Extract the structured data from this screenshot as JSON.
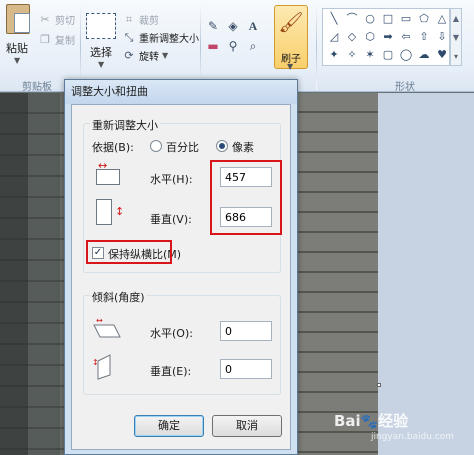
{
  "ribbon": {
    "clipboard": {
      "paste": "粘贴",
      "cut": "剪切",
      "copy": "复制",
      "group": "剪贴板"
    },
    "image": {
      "select": "选择",
      "crop": "裁剪",
      "resize": "重新调整大小",
      "rotate": "旋转"
    },
    "tools": {
      "brush": "刷子"
    },
    "shapes": {
      "group": "形状",
      "items": [
        "╲",
        "⌒",
        "○",
        "□",
        "▭",
        "⬠",
        "△",
        "◿",
        "◇",
        "⬡",
        "➡",
        "⇦",
        "⇧",
        "⇩",
        "✦",
        "✧",
        "✶",
        "▢",
        "◯",
        "☁",
        "♥"
      ]
    }
  },
  "dialog": {
    "title": "调整大小和扭曲",
    "resize_legend": "重新调整大小",
    "by_label": "依据(B):",
    "percent_label": "百分比",
    "pixels_label": "像素",
    "horizontal_label": "水平(H):",
    "horizontal_value": "457",
    "vertical_label": "垂直(V):",
    "vertical_value": "686",
    "keep_ratio_label": "保持纵横比(M)",
    "skew_legend": "倾斜(角度)",
    "skew_h_label": "水平(O):",
    "skew_h_value": "0",
    "skew_v_label": "垂直(E):",
    "skew_v_value": "0",
    "ok": "确定",
    "cancel": "取消"
  },
  "watermark": {
    "brand": "Bai",
    "brand2": "经验",
    "sub": "jingyan.baidu.com"
  },
  "colors": {
    "highlight_red": "#d7151b",
    "brush_active": "#f9cf6b"
  }
}
